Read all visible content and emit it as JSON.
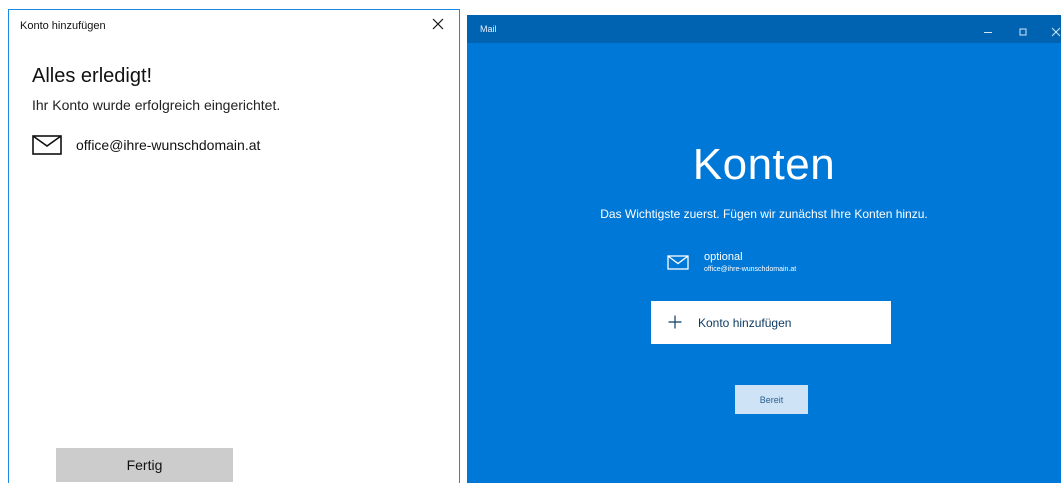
{
  "dialog": {
    "title": "Konto hinzufügen",
    "heading": "Alles erledigt!",
    "subtitle": "Ihr Konto wurde erfolgreich eingerichtet.",
    "account_email": "office@ihre-wunschdomain.at",
    "done_label": "Fertig",
    "icons": {
      "close": "close-icon",
      "account": "mail-icon"
    }
  },
  "mail": {
    "app_title": "Mail",
    "heading": "Konten",
    "subtitle": "Das Wichtigste zuerst. Fügen wir zunächst Ihre Konten hinzu.",
    "account": {
      "name": "optional",
      "email": "office@ihre-wunschdomain.at"
    },
    "add_account_label": "Konto hinzufügen",
    "ready_label": "Bereit",
    "icons": {
      "minimize": "minimize-icon",
      "maximize": "maximize-icon",
      "close": "close-icon",
      "account": "mail-icon",
      "add": "plus-icon"
    }
  },
  "colors": {
    "accent": "#0078d7",
    "titlebar": "#0063b1",
    "dialog_border": "#1e88e5",
    "done_button": "#cccccc",
    "ready_button": "#cfe3f7"
  }
}
